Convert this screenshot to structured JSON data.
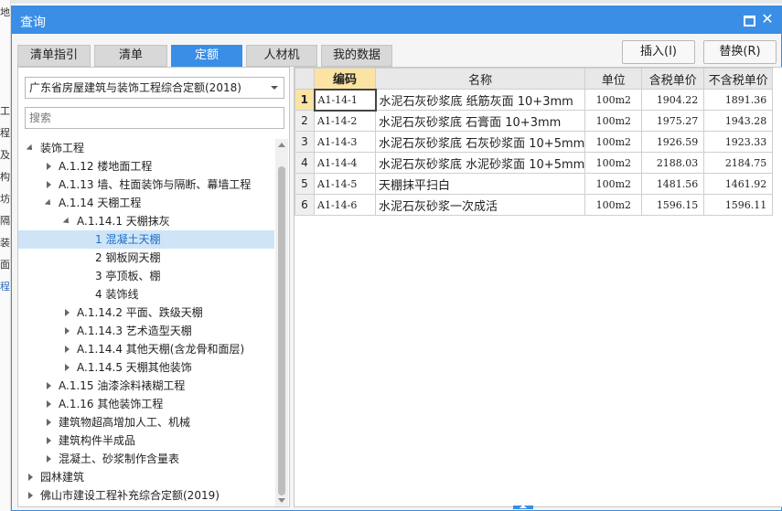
{
  "background": {
    "left_chars": [
      "地",
      "工",
      "程",
      "及",
      "构",
      "坊",
      "隔",
      "装",
      "面",
      "程"
    ]
  },
  "dialog": {
    "title": "查询"
  },
  "tabs": [
    {
      "label": "清单指引",
      "active": false
    },
    {
      "label": "清单",
      "active": false
    },
    {
      "label": "定额",
      "active": true
    },
    {
      "label": "人材机",
      "active": false
    },
    {
      "label": "我的数据",
      "active": false
    }
  ],
  "buttons": {
    "insert": "插入(I)",
    "replace": "替换(R)"
  },
  "left": {
    "dropdown_value": "广东省房屋建筑与装饰工程综合定额(2018)",
    "search_placeholder": "搜索"
  },
  "tree": [
    {
      "label": "装饰工程",
      "level": 1,
      "state": "expanded"
    },
    {
      "label": "A.1.12 楼地面工程",
      "level": 2,
      "state": "collapsed"
    },
    {
      "label": "A.1.13 墙、柱面装饰与隔断、幕墙工程",
      "level": 2,
      "state": "collapsed"
    },
    {
      "label": "A.1.14 天棚工程",
      "level": 2,
      "state": "expanded"
    },
    {
      "label": "A.1.14.1 天棚抹灰",
      "level": 3,
      "state": "expanded"
    },
    {
      "label": "1 混凝土天棚",
      "level": 4,
      "state": "leaf",
      "selected": true
    },
    {
      "label": "2 钢板网天棚",
      "level": 4,
      "state": "leaf"
    },
    {
      "label": "3 亭顶板、棚",
      "level": 4,
      "state": "leaf"
    },
    {
      "label": "4 装饰线",
      "level": 4,
      "state": "leaf"
    },
    {
      "label": "A.1.14.2 平面、跌级天棚",
      "level": 3,
      "state": "collapsed"
    },
    {
      "label": "A.1.14.3 艺术造型天棚",
      "level": 3,
      "state": "collapsed"
    },
    {
      "label": "A.1.14.4 其他天棚(含龙骨和面层)",
      "level": 3,
      "state": "collapsed"
    },
    {
      "label": "A.1.14.5 天棚其他装饰",
      "level": 3,
      "state": "collapsed"
    },
    {
      "label": "A.1.15 油漆涂料裱糊工程",
      "level": 2,
      "state": "collapsed"
    },
    {
      "label": "A.1.16 其他装饰工程",
      "level": 2,
      "state": "collapsed"
    },
    {
      "label": "建筑物超高增加人工、机械",
      "level": 2,
      "state": "collapsed"
    },
    {
      "label": "建筑构件半成品",
      "level": 2,
      "state": "collapsed"
    },
    {
      "label": "混凝土、砂浆制作含量表",
      "level": 2,
      "state": "collapsed"
    },
    {
      "label": "园林建筑",
      "level": 1,
      "state": "collapsed"
    },
    {
      "label": "佛山市建设工程补充综合定额(2019)",
      "level": 1,
      "state": "collapsed"
    }
  ],
  "grid": {
    "columns": [
      "",
      "编码",
      "名称",
      "单位",
      "含税单价",
      "不含税单价"
    ],
    "rows": [
      {
        "n": "1",
        "code": "A1-14-1",
        "name": "水泥石灰砂浆底 纸筋灰面 10+3mm",
        "unit": "100m2",
        "tax": "1904.22",
        "notax": "1891.36"
      },
      {
        "n": "2",
        "code": "A1-14-2",
        "name": "水泥石灰砂浆底 石膏面 10+3mm",
        "unit": "100m2",
        "tax": "1975.27",
        "notax": "1943.28"
      },
      {
        "n": "3",
        "code": "A1-14-3",
        "name": "水泥石灰砂浆底 石灰砂浆面 10+5mm",
        "unit": "100m2",
        "tax": "1926.59",
        "notax": "1923.33"
      },
      {
        "n": "4",
        "code": "A1-14-4",
        "name": "水泥石灰砂浆底 水泥砂浆面 10+5mm",
        "unit": "100m2",
        "tax": "2188.03",
        "notax": "2184.75"
      },
      {
        "n": "5",
        "code": "A1-14-5",
        "name": "天棚抹平扫白",
        "unit": "100m2",
        "tax": "1481.56",
        "notax": "1461.92"
      },
      {
        "n": "6",
        "code": "A1-14-6",
        "name": "水泥石灰砂浆一次成活",
        "unit": "100m2",
        "tax": "1596.15",
        "notax": "1596.11"
      }
    ]
  }
}
